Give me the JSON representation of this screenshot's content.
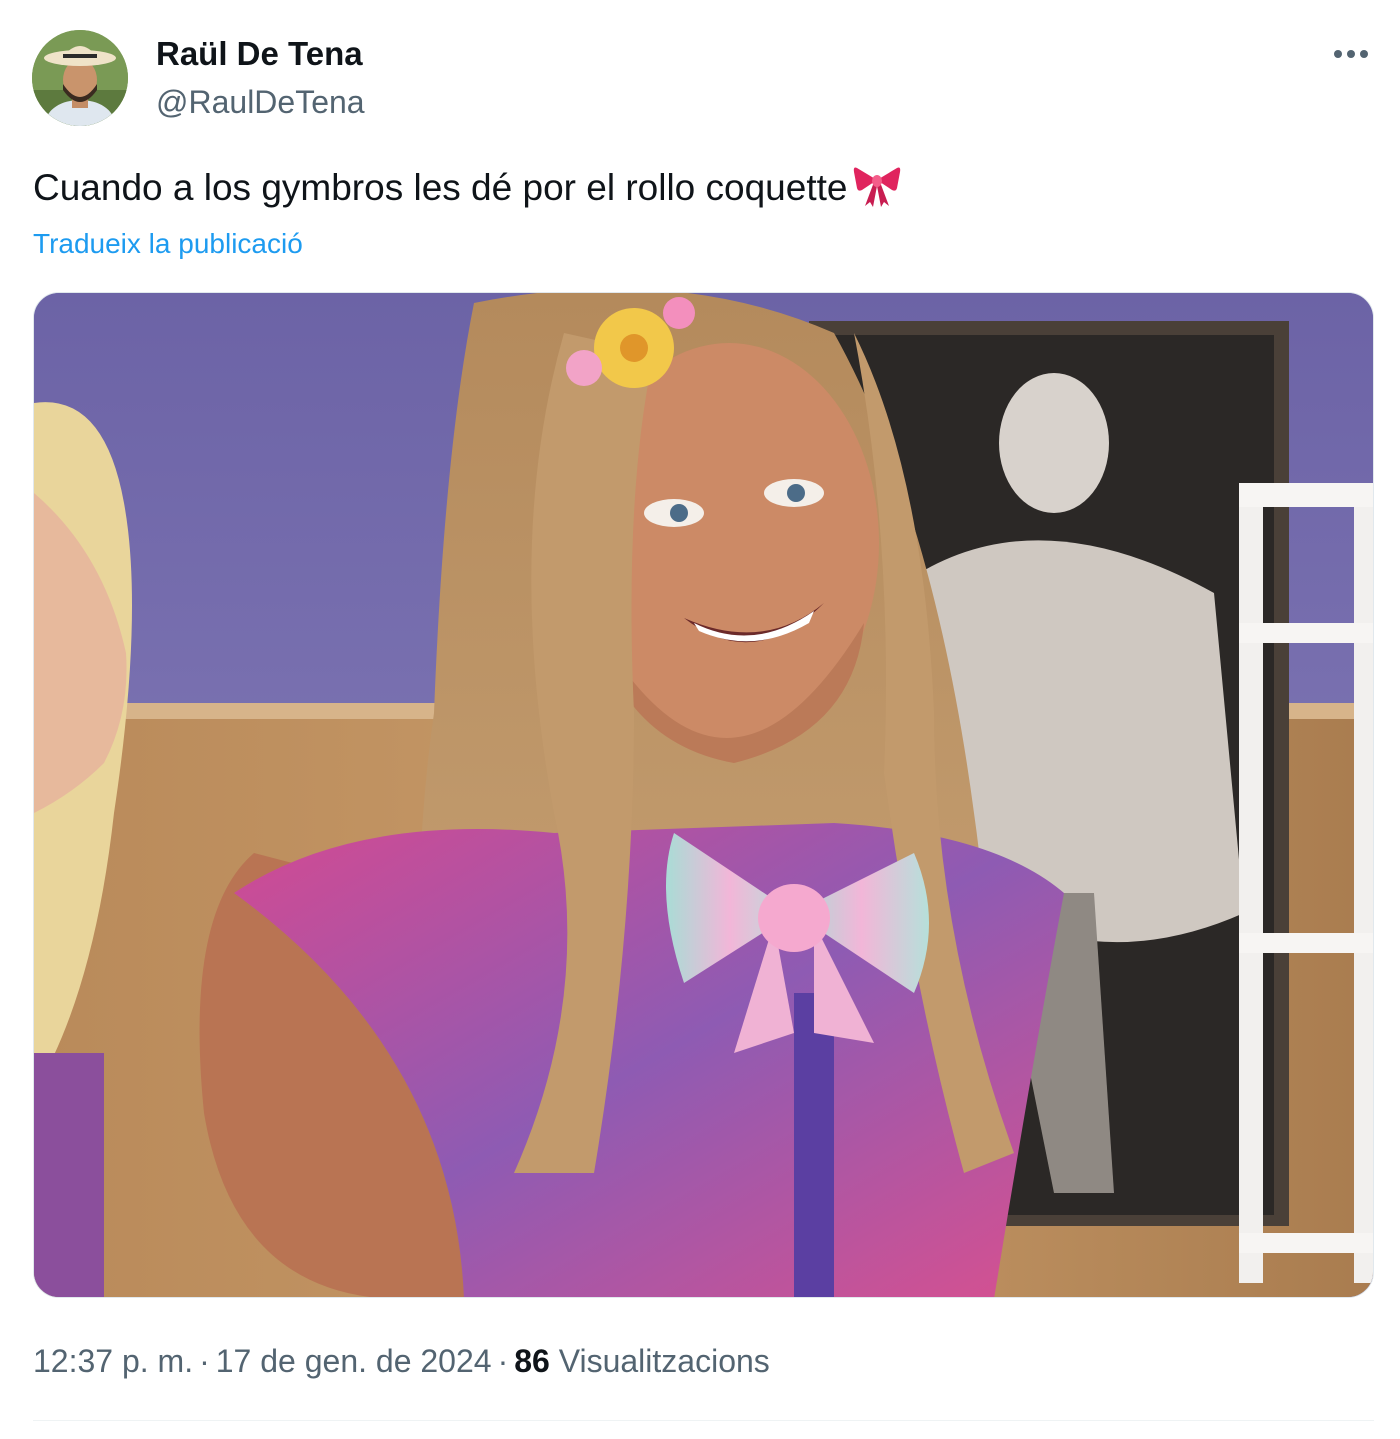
{
  "author": {
    "name": "Raül De Tena",
    "handle": "@RaulDeTena"
  },
  "tweet": {
    "text": "Cuando a los gymbros les dé por el rollo coquette",
    "emoji_icon": "ribbon-icon",
    "translate_label": "Tradueix la publicació"
  },
  "meta": {
    "time": "12:37 p. m.",
    "separator": "·",
    "date": "17 de gen. de 2024",
    "views_count": "86",
    "views_label": "Visualitzacions"
  },
  "icons": {
    "more": "more-options-icon"
  },
  "colors": {
    "text": "#0f1419",
    "secondary": "#536471",
    "link": "#1d9bf0",
    "divider": "#eff3f4"
  }
}
